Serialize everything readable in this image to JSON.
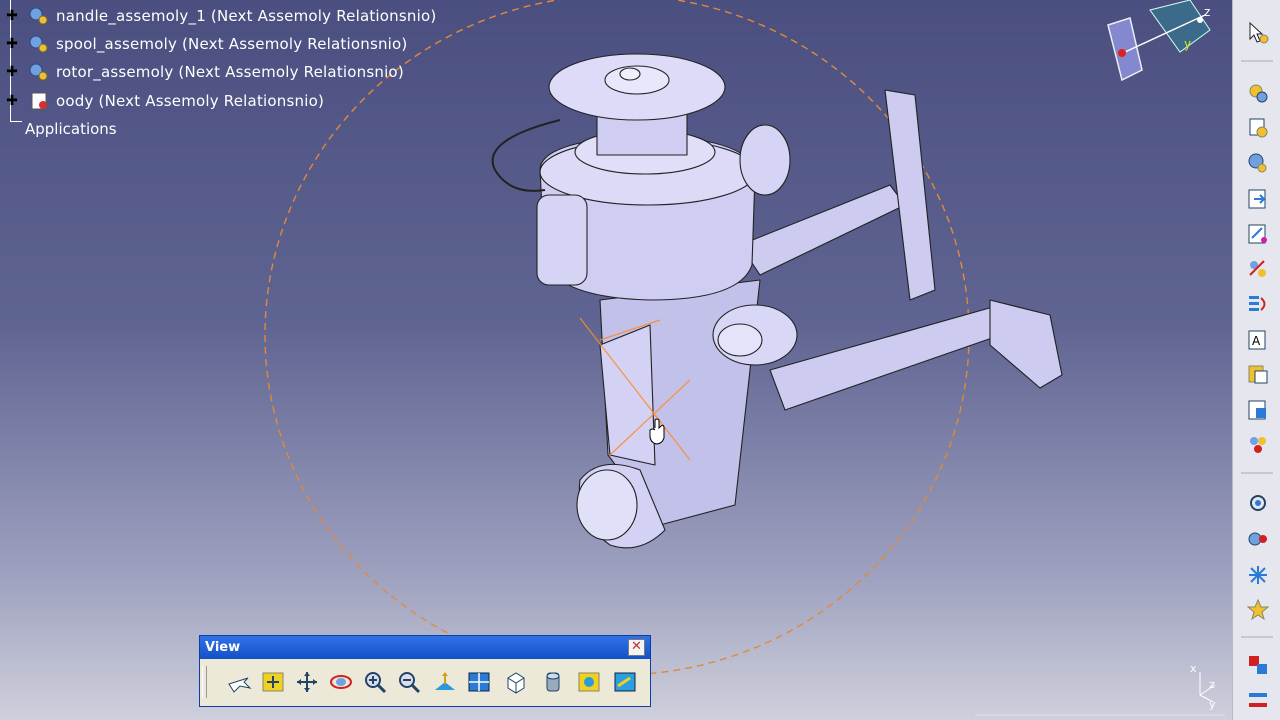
{
  "tree": {
    "items": [
      {
        "label": "nandle_assemoly_1 (Next Assemoly Relationsnio)",
        "icon": "assembly-gear-icon"
      },
      {
        "label": "spool_assemoly (Next Assemoly Relationsnio)",
        "icon": "assembly-gear-icon"
      },
      {
        "label": "rotor_assemoly (Next Assemoly Relationsnio)",
        "icon": "assembly-gear-icon"
      },
      {
        "label": "oody (Next Assemoly Relationsnio)",
        "icon": "part-body-icon"
      }
    ],
    "applications_label": "Applications"
  },
  "view_toolbar": {
    "title": "View",
    "close_label": "✕",
    "tools": [
      "fly-mode-icon",
      "fit-all-icon",
      "pan-icon",
      "rotate-icon",
      "zoom-in-icon",
      "zoom-out-icon",
      "normal-view-icon",
      "multi-view-icon",
      "iso-view-icon",
      "shading-icon",
      "hide-show-icon",
      "swap-space-icon"
    ]
  },
  "compass": {
    "axis_labels": [
      "z",
      "y"
    ]
  },
  "mini_axis": {
    "labels": [
      "x",
      "z",
      "y"
    ]
  },
  "colors": {
    "bg_top": "#4a4f80",
    "bg_bottom": "#cfd0dc",
    "part_fill": "#c9c8ee",
    "highlight_orange": "#ff8a2a",
    "titlebar_blue": "#1f5fd8"
  }
}
